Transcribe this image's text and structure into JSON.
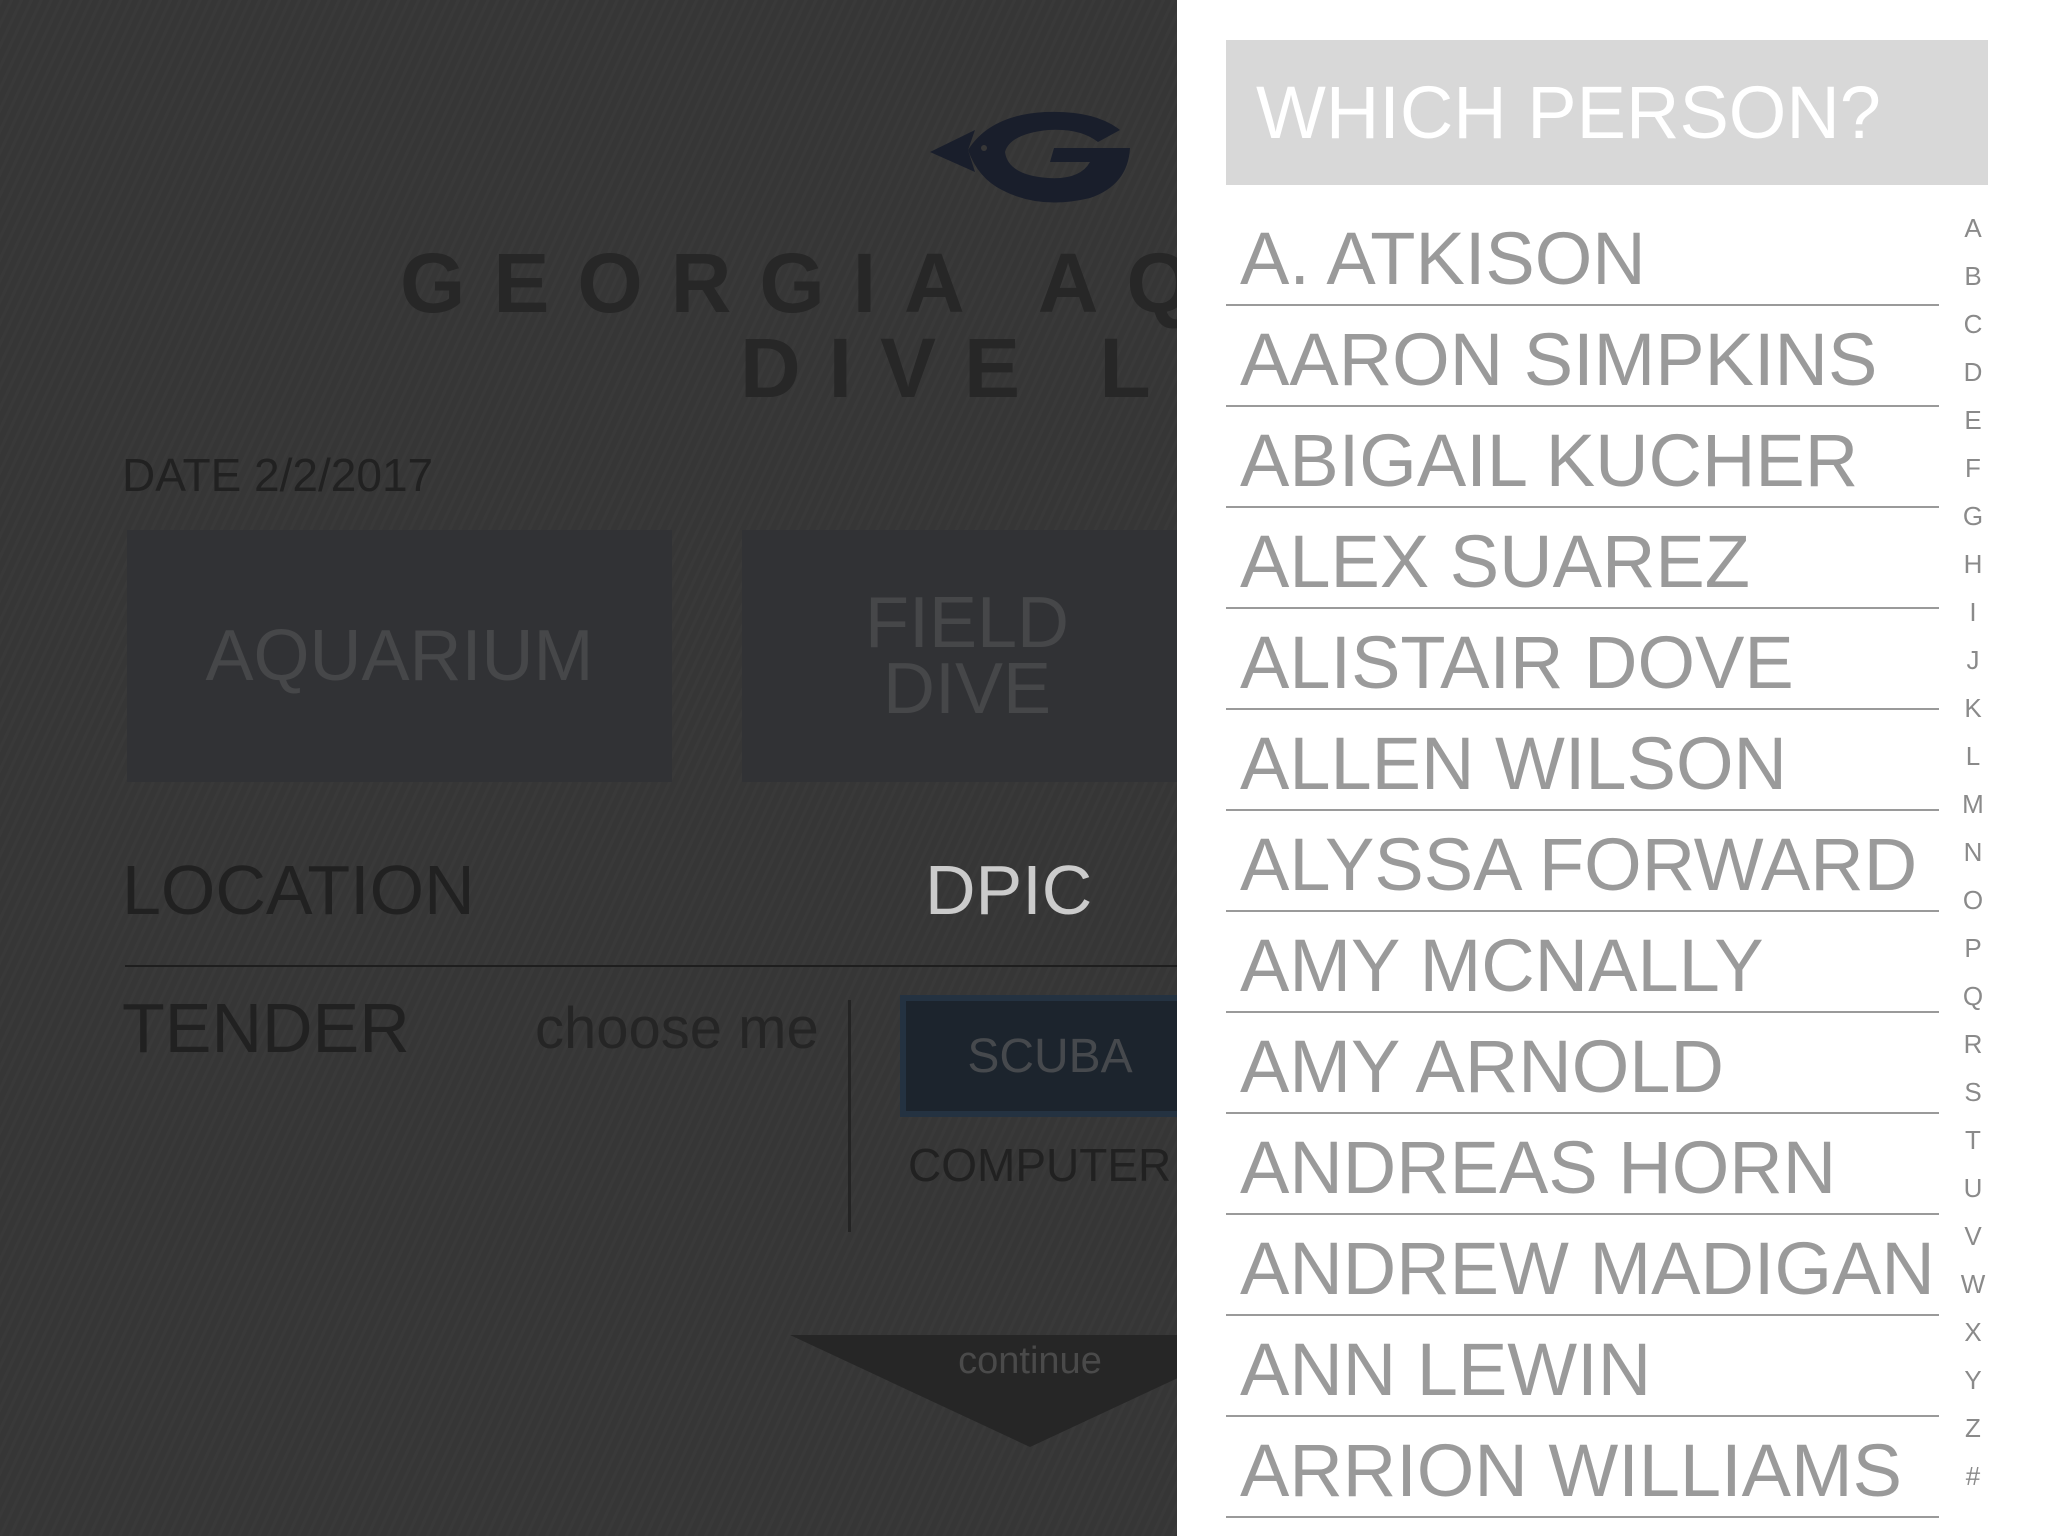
{
  "form": {
    "org_name": "GEORGIA AQ",
    "app_subtitle": "DIVE LO",
    "date_label": "DATE 2/2/2017",
    "dive_types": [
      "AQUARIUM",
      "FIELD\nDIVE"
    ],
    "location_label": "LOCATION",
    "location_value": "DPIC",
    "tender_label": "TENDER",
    "tender_value": "choose me",
    "scuba_label": "SCUBA",
    "computer_label": "COMPUTER",
    "continue_label": "continue"
  },
  "colors": {
    "logo_navy": "#1c2233",
    "panel_header": "#d8d8d8",
    "list_text": "#9a9a9a"
  },
  "person_picker": {
    "title": "WHICH PERSON?",
    "people": [
      "A. ATKISON",
      "AARON SIMPKINS",
      "ABIGAIL KUCHER",
      "ALEX SUAREZ",
      "ALISTAIR DOVE",
      "ALLEN WILSON",
      "ALYSSA FORWARD",
      "AMY MCNALLY",
      "AMY ARNOLD",
      "ANDREAS HORN",
      "ANDREW MADIGAN",
      "ANN LEWIN",
      "ARRION WILLIAMS"
    ],
    "alpha_index": [
      "A",
      "B",
      "C",
      "D",
      "E",
      "F",
      "G",
      "H",
      "I",
      "J",
      "K",
      "L",
      "M",
      "N",
      "O",
      "P",
      "Q",
      "R",
      "S",
      "T",
      "U",
      "V",
      "W",
      "X",
      "Y",
      "Z",
      "#"
    ]
  }
}
